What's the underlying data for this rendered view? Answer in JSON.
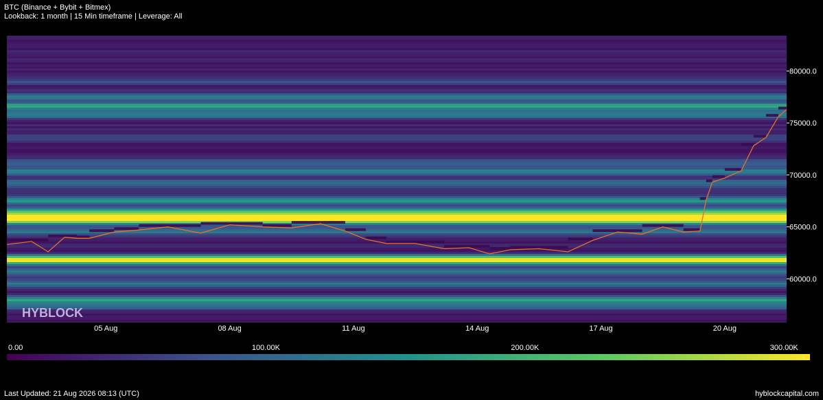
{
  "header": {
    "title": "BTC (Binance + Bybit + Bitmex)",
    "subtitle": "Lookback: 1 month | 15 Min timeframe | Leverage: All"
  },
  "watermark": "HYBLOCK",
  "footer": {
    "updated": "Last Updated: 21 Aug 2026 08:13 (UTC)",
    "site": "hyblockcapital.com"
  },
  "colors": {
    "background": "#000000",
    "price_line": "#e8702a",
    "scale": [
      "#440154",
      "#3b528b",
      "#21918c",
      "#5ec962",
      "#fde725"
    ]
  },
  "chart_data": {
    "type": "heatmap",
    "x_tick_labels": [
      "05 Aug",
      "08 Aug",
      "11 Aug",
      "14 Aug",
      "17 Aug",
      "20 Aug"
    ],
    "x_tick_days": [
      5,
      8,
      11,
      14,
      17,
      20
    ],
    "x_range_days": [
      2.6,
      21.5
    ],
    "y_tick_labels": [
      "80000.0",
      "75000.0",
      "70000.0",
      "65000.0",
      "60000.0"
    ],
    "y_tick_values": [
      80000,
      75000,
      70000,
      65000,
      60000
    ],
    "ylim": [
      55800,
      83400
    ],
    "colorbar": {
      "tick_labels": [
        "0.00",
        "100.00K",
        "200.00K",
        "300.00K"
      ],
      "tick_values": [
        0,
        100000,
        200000,
        300000
      ],
      "range": [
        0,
        310000
      ]
    },
    "liquidation_bands": [
      {
        "price": 79200,
        "intensity": 0.14
      },
      {
        "price": 77600,
        "intensity": 0.33
      },
      {
        "price": 76700,
        "intensity": 0.5
      },
      {
        "price": 75900,
        "intensity": 0.36
      },
      {
        "price": 73700,
        "intensity": 0.12
      },
      {
        "price": 71200,
        "intensity": 0.22
      },
      {
        "price": 70400,
        "intensity": 0.34
      },
      {
        "price": 69300,
        "intensity": 0.3
      },
      {
        "price": 67600,
        "intensity": 0.44
      },
      {
        "price": 66600,
        "intensity": 0.52
      },
      {
        "price": 66100,
        "intensity": 0.62
      },
      {
        "price": 65700,
        "intensity": 0.78
      },
      {
        "price": 64700,
        "intensity": 0.3
      },
      {
        "price": 62100,
        "intensity": 0.44
      },
      {
        "price": 61800,
        "intensity": 0.62
      },
      {
        "price": 60800,
        "intensity": 0.36
      },
      {
        "price": 59600,
        "intensity": 0.32
      },
      {
        "price": 58100,
        "intensity": 0.44
      },
      {
        "price": 57500,
        "intensity": 0.3
      }
    ],
    "price_series": {
      "x_days": [
        2.6,
        3.2,
        3.6,
        4.0,
        4.3,
        4.6,
        5.2,
        5.8,
        6.5,
        7.3,
        8.0,
        8.8,
        9.5,
        10.2,
        10.8,
        11.3,
        11.8,
        12.5,
        13.2,
        13.8,
        14.3,
        14.8,
        15.5,
        16.2,
        16.8,
        17.4,
        18.0,
        18.5,
        19.0,
        19.4,
        19.55,
        19.7,
        20.0,
        20.4,
        20.7,
        21.0,
        21.3,
        21.5
      ],
      "y_price": [
        63300,
        63600,
        62600,
        64000,
        63900,
        63900,
        64500,
        64700,
        65000,
        64400,
        65200,
        65000,
        64900,
        65300,
        64600,
        63800,
        63400,
        63400,
        62900,
        63000,
        62400,
        62800,
        62900,
        62600,
        63700,
        64500,
        64300,
        65000,
        64500,
        64600,
        67600,
        69300,
        69700,
        70400,
        72800,
        73600,
        75600,
        76300
      ]
    }
  }
}
